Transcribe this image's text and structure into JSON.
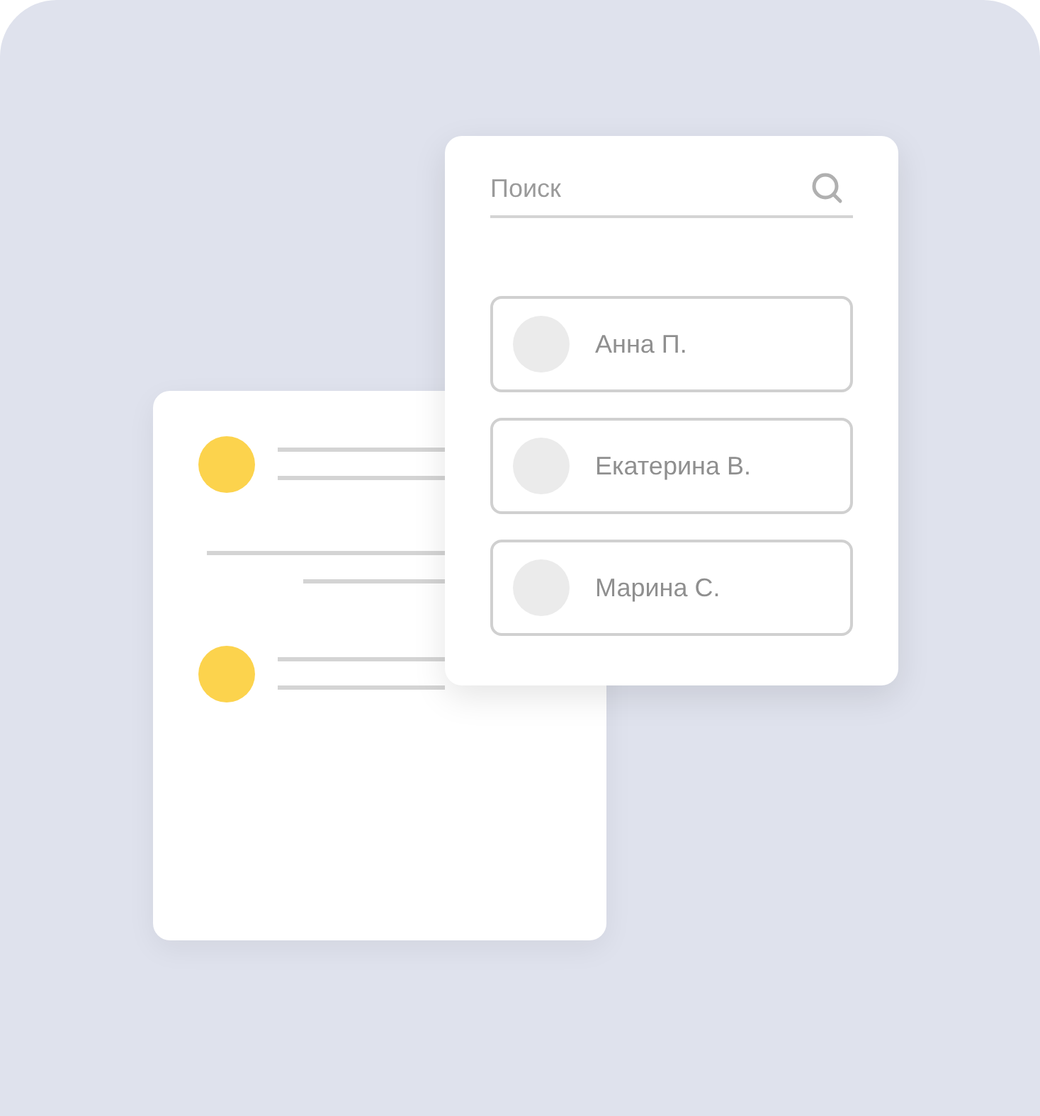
{
  "search": {
    "placeholder": "Поиск"
  },
  "contacts": [
    {
      "name": "Анна П."
    },
    {
      "name": "Екатерина В."
    },
    {
      "name": "Марина С."
    }
  ]
}
